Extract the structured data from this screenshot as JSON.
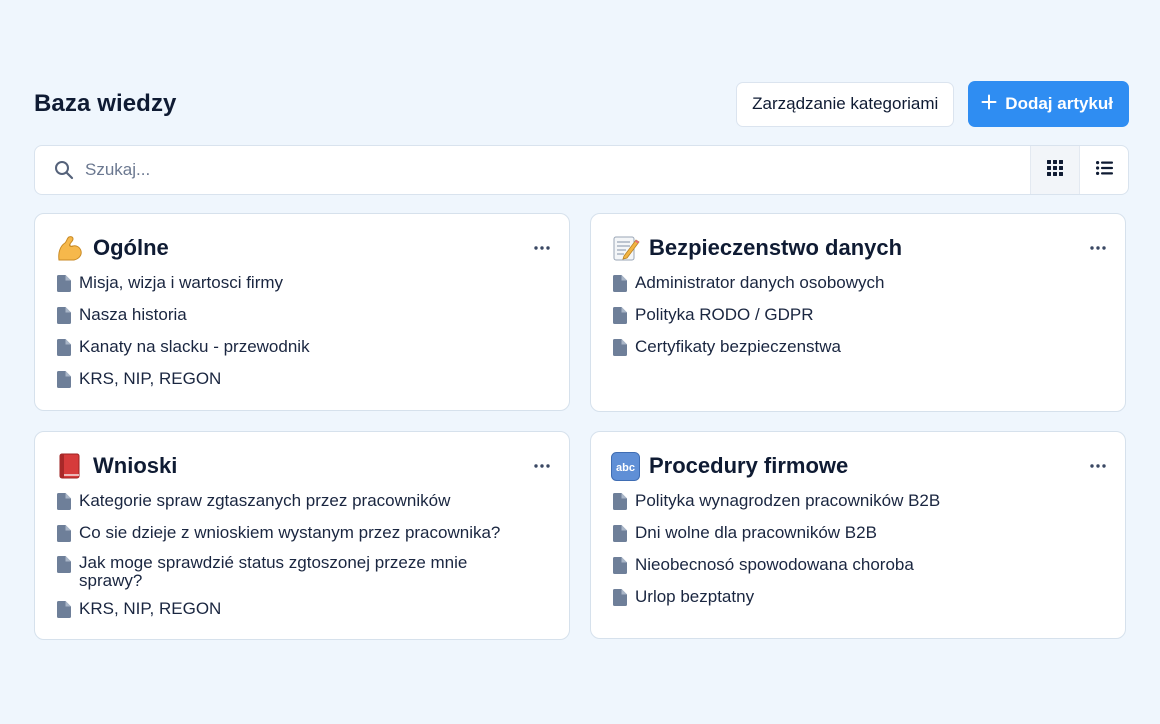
{
  "header": {
    "title": "Baza wiedzy",
    "manage_label": "Zarządzanie kategoriami",
    "add_label": "Dodaj artykuł"
  },
  "search": {
    "placeholder": "Szukaj..."
  },
  "icons": {
    "search": "search-icon",
    "grid_view": "grid-icon",
    "list_view": "list-icon",
    "more": "more-horizontal-icon",
    "document": "document-icon"
  },
  "colors": {
    "primary": "#2f8df2",
    "background": "#eff6fd",
    "doc_icon": "#6e7f99"
  },
  "categories": [
    {
      "emoji": "💪",
      "title": "Ogólne",
      "articles": [
        "Misja, wizja i wartosci firmy",
        "Nasza historia",
        "Kanaty na slacku - przewodnik",
        "KRS, NIP, REGON"
      ]
    },
    {
      "emoji": "📝",
      "title": "Bezpieczenstwo danych",
      "articles": [
        "Administrator danych osobowych",
        "Polityka RODO / GDPR",
        "Certyfikaty bezpieczenstwa"
      ]
    },
    {
      "emoji": "📕",
      "title": "Wnioski",
      "articles": [
        "Kategorie spraw zgtaszanych przez pracowników",
        "Co sie dzieje z wnioskiem wystanym przez pracownika?",
        "Jak moge sprawdzié status zgtoszonej przeze mnie sprawy?",
        "KRS, NIP, REGON"
      ]
    },
    {
      "emoji": "🔤",
      "title": "Procedury firmowe",
      "articles": [
        "Polityka wynagrodzen pracowników B2B",
        "Dni wolne dla pracowników B2B",
        "Nieobecnosó spowodowana choroba",
        "Urlop bezptatny"
      ]
    }
  ]
}
